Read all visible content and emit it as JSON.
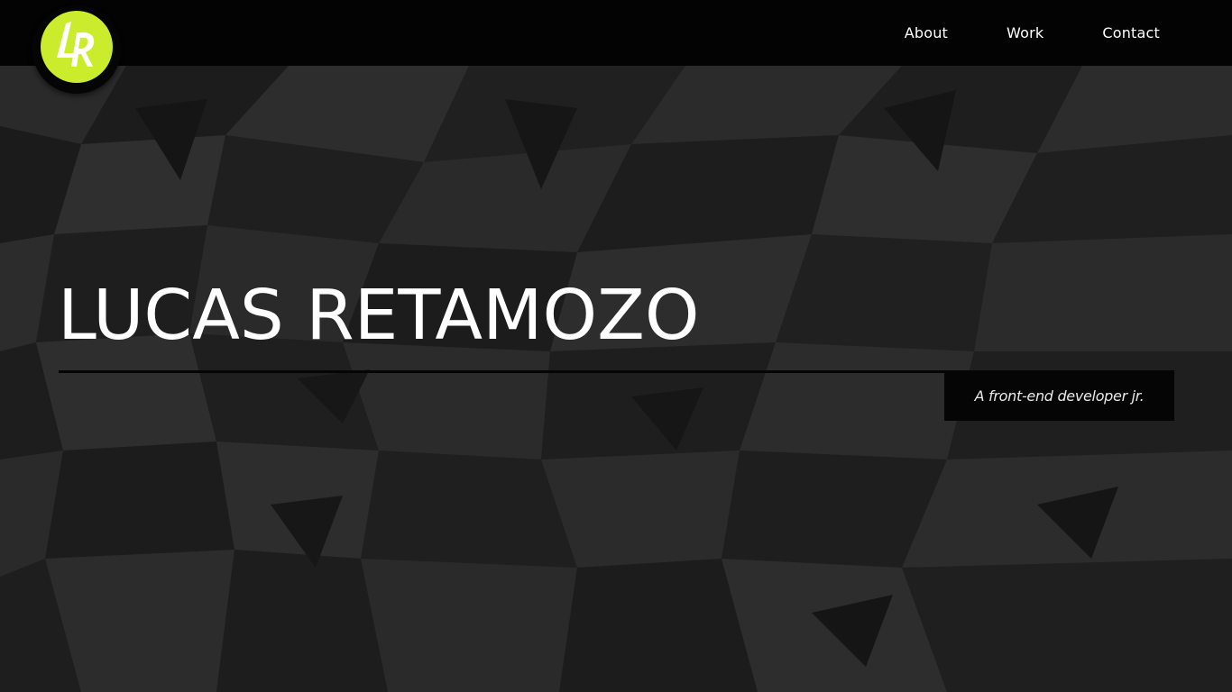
{
  "header": {
    "logo_text": "LR",
    "nav": [
      {
        "label": "About"
      },
      {
        "label": "Work"
      },
      {
        "label": "Contact"
      }
    ]
  },
  "hero": {
    "name": "LUCAS RETAMOZO",
    "tagline": "A front-end developer jr."
  },
  "colors": {
    "accent": "#cbec2c",
    "navbar": "#030303",
    "background": "#232323",
    "text": "#ffffff"
  },
  "icons": {
    "logo": "lr-monogram-logo"
  }
}
